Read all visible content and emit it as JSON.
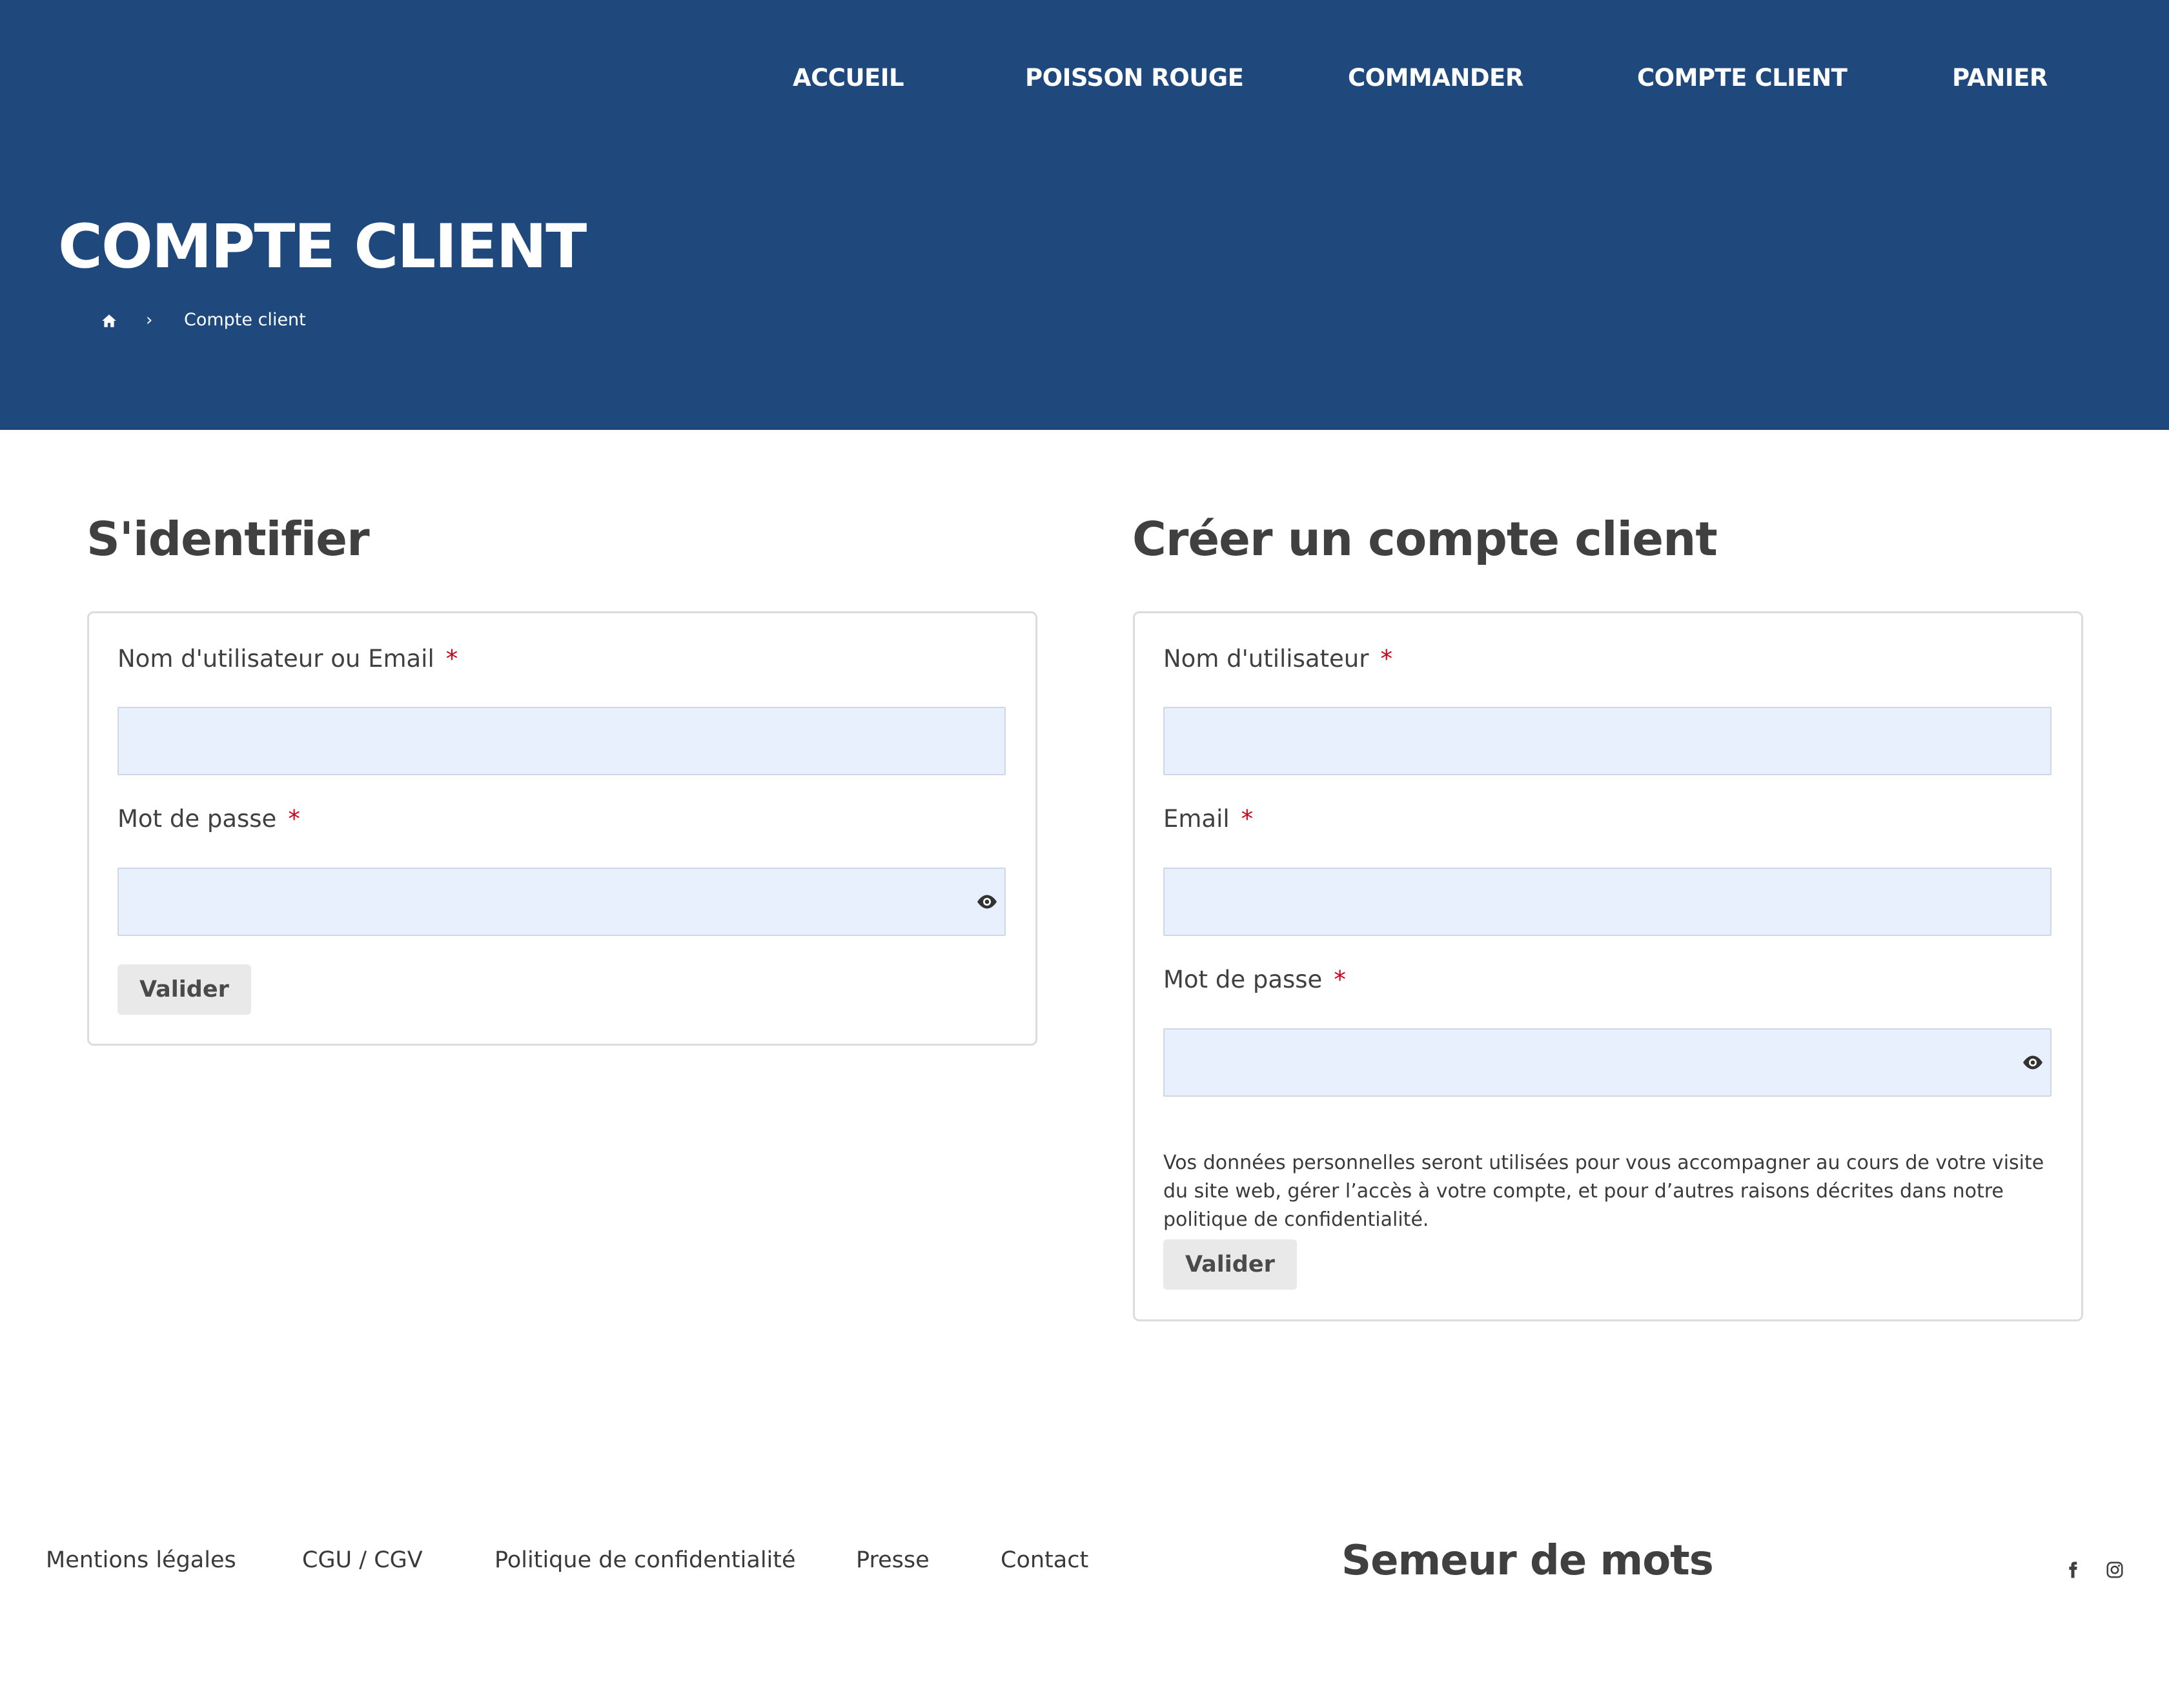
{
  "nav": {
    "items": [
      {
        "label": "ACCUEIL"
      },
      {
        "label": "POISSON ROUGE"
      },
      {
        "label": "COMMANDER"
      },
      {
        "label": "COMPTE CLIENT"
      },
      {
        "label": "PANIER"
      }
    ]
  },
  "hero": {
    "title": "COMPTE CLIENT",
    "breadcrumb": {
      "home_icon": "home-icon",
      "separator": "›",
      "current": "Compte client"
    }
  },
  "login": {
    "title": "S'identifier",
    "username_label": "Nom d'utilisateur ou Email",
    "username_value": "",
    "password_label": "Mot de passe",
    "password_value": "",
    "required_mark": "*",
    "submit_label": "Valider"
  },
  "register": {
    "title": "Créer un compte client",
    "username_label": "Nom d'utilisateur",
    "username_value": "",
    "email_label": "Email",
    "email_value": "",
    "password_label": "Mot de passe",
    "password_value": "",
    "required_mark": "*",
    "privacy_text": "Vos données personnelles seront utilisées pour vous accompagner au cours de votre visite du site web, gérer l’accès à votre compte, et pour d’autres raisons décrites dans notre politique de confidentialité.",
    "submit_label": "Valider"
  },
  "footer": {
    "links": [
      {
        "label": "Mentions légales"
      },
      {
        "label": "CGU / CGV"
      },
      {
        "label": "Politique de confidentialité"
      },
      {
        "label": "Presse"
      },
      {
        "label": "Contact"
      }
    ],
    "brand": "Semeur de mots",
    "social": [
      "facebook-icon",
      "instagram-icon"
    ]
  },
  "colors": {
    "header_bg": "#1f497d",
    "input_bg": "#e8f0fe",
    "required": "#d0021b",
    "button_bg": "#e9e9e9",
    "text_dark": "#404040"
  }
}
